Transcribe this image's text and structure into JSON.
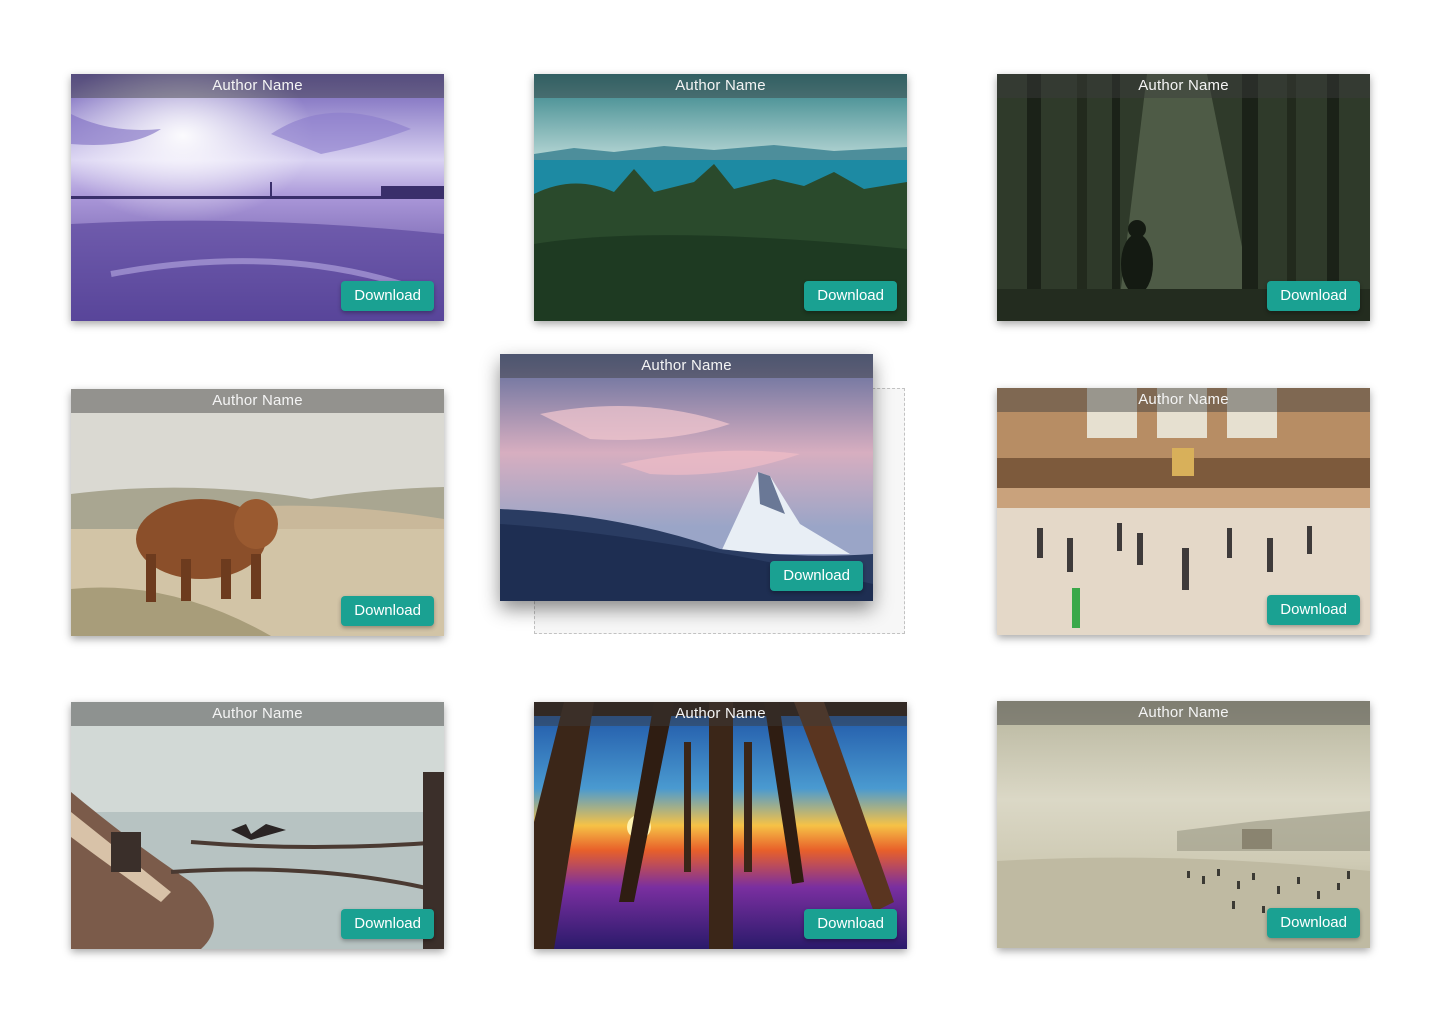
{
  "cards": [
    {
      "author": "Author Name",
      "download_label": "Download",
      "scene": "purple-bridge-seascape"
    },
    {
      "author": "Author Name",
      "download_label": "Download",
      "scene": "forest-lake-mountains"
    },
    {
      "author": "Author Name",
      "download_label": "Download",
      "scene": "sunlit-dark-forest"
    },
    {
      "author": "Author Name",
      "download_label": "Download",
      "scene": "highland-cow-beach"
    },
    {
      "author": "Author Name",
      "download_label": "Download",
      "scene": "snowy-mountain-peak-sunset"
    },
    {
      "author": "Author Name",
      "download_label": "Download",
      "scene": "busy-train-station-hall"
    },
    {
      "author": "Author Name",
      "download_label": "Download",
      "scene": "boat-with-cormorant"
    },
    {
      "author": "Author Name",
      "download_label": "Download",
      "scene": "under-pier-sunset"
    },
    {
      "author": "Author Name",
      "download_label": "Download",
      "scene": "hazy-crowded-beach"
    }
  ],
  "colors": {
    "download_button": "#1aa192",
    "author_bar": "rgba(60,60,60,0.45)",
    "placeholder_border": "#c2c2c2"
  }
}
